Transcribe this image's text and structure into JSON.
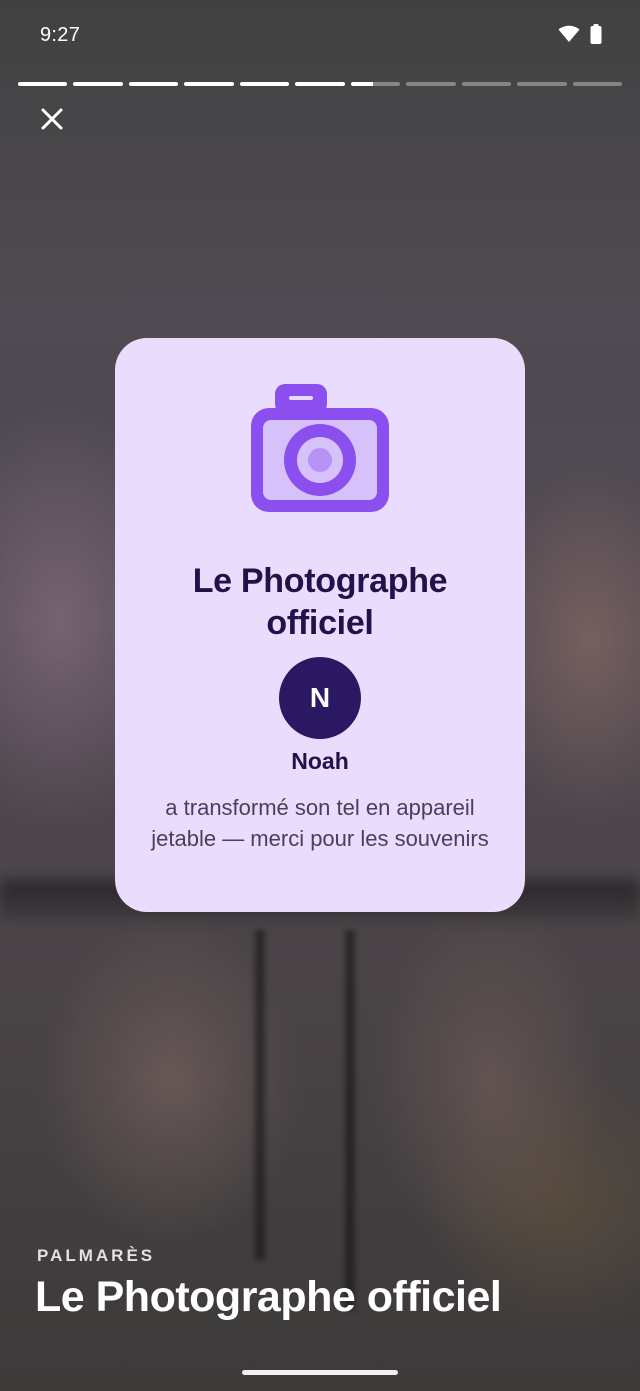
{
  "status_bar": {
    "time": "9:27",
    "icons": [
      "wifi-icon",
      "battery-icon"
    ]
  },
  "story_progress": {
    "segments": [
      1,
      1,
      1,
      1,
      1,
      1,
      0.45,
      0,
      0,
      0,
      0
    ]
  },
  "award_card": {
    "icon": "camera-icon",
    "title": "Le Photographe officiel",
    "avatar_initial": "N",
    "name": "Noah",
    "caption": "a transformé son tel en appareil jetable — merci pour les souvenirs"
  },
  "footer": {
    "section_label": "PALMARÈS",
    "title": "Le Photographe officiel"
  },
  "colors": {
    "card_bg": "#e9dcfd",
    "accent": "#8b4ff0",
    "title": "#22124a",
    "avatar": "#2b1863"
  }
}
